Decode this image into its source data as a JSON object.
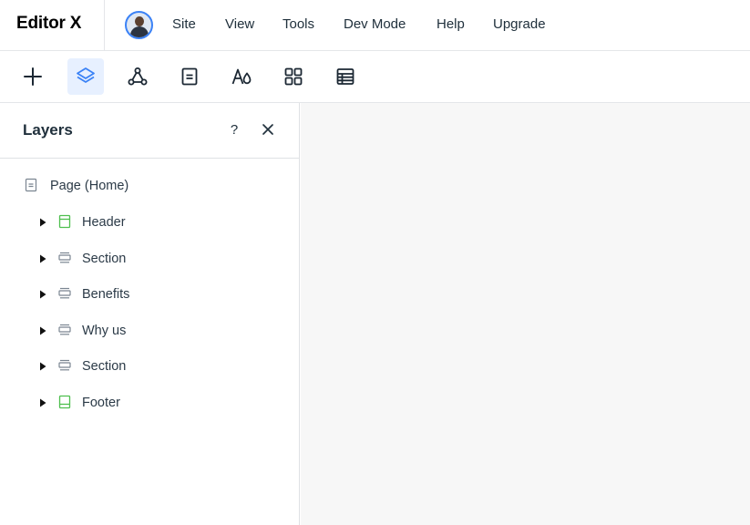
{
  "app": {
    "brand": "Editor X"
  },
  "menu": {
    "site": "Site",
    "view": "View",
    "tools": "Tools",
    "dev_mode": "Dev Mode",
    "help": "Help",
    "upgrade": "Upgrade"
  },
  "toolbar": {
    "items": [
      {
        "icon": "plus-icon",
        "active": false
      },
      {
        "icon": "layers-icon",
        "active": true
      },
      {
        "icon": "connect-nodes-icon",
        "active": false
      },
      {
        "icon": "page-icon",
        "active": false
      },
      {
        "icon": "text-theme-icon",
        "active": false
      },
      {
        "icon": "grid-apps-icon",
        "active": false
      },
      {
        "icon": "table-icon",
        "active": false
      }
    ]
  },
  "layers": {
    "title": "Layers",
    "help": "?",
    "page": "Page (Home)",
    "items": [
      {
        "label": "Header",
        "icon": "header-layer-icon",
        "color": "#4fbf4f"
      },
      {
        "label": "Section",
        "icon": "section-layer-icon",
        "color": "#7a8591"
      },
      {
        "label": "Benefits",
        "icon": "section-layer-icon",
        "color": "#7a8591"
      },
      {
        "label": "Why us",
        "icon": "section-layer-icon",
        "color": "#7a8591"
      },
      {
        "label": "Section",
        "icon": "section-layer-icon",
        "color": "#7a8591"
      },
      {
        "label": "Footer",
        "icon": "footer-layer-icon",
        "color": "#4fbf4f"
      }
    ]
  },
  "colors": {
    "accent": "#3b82f6",
    "active_bg": "#e7f0ff",
    "canvas": "#f7f7f7",
    "green": "#4fbf4f"
  }
}
